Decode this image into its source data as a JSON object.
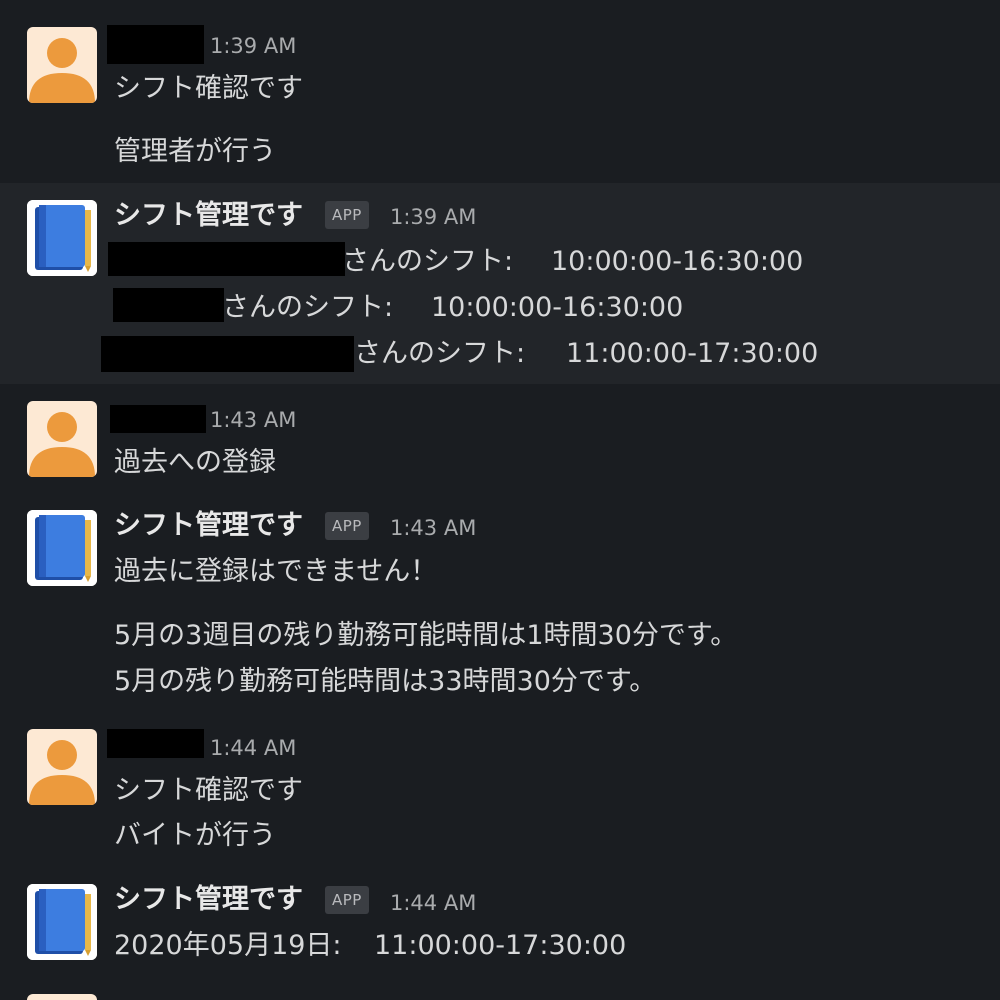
{
  "colors": {
    "background": "#1a1d21",
    "highlight_row": "#222529",
    "user_avatar_bg": "#fde9d4",
    "user_avatar_fg": "#ec9a3d",
    "app_icon_blue": "#2f6fd6",
    "text": "#d7d8d9",
    "timestamp": "#a9abad"
  },
  "app_name": "シフト管理です",
  "app_badge": "APP",
  "messages": [
    {
      "author": "user",
      "avatar_icon": "user-avatar-icon",
      "time": "1:39 AM",
      "lines": [
        "シフト確認です",
        "管理者が行う"
      ]
    },
    {
      "author": "app",
      "avatar_icon": "notebook-app-icon",
      "time": "1:39 AM",
      "lines": [
        {
          "suffix": "さんのシフト:",
          "range": "10:00:00-16:30:00"
        },
        {
          "suffix": "さんのシフト:",
          "range": "10:00:00-16:30:00"
        },
        {
          "suffix": "さんのシフト:",
          "range": "11:00:00-17:30:00"
        }
      ]
    },
    {
      "author": "user",
      "avatar_icon": "user-avatar-icon",
      "time": "1:43 AM",
      "lines": [
        "過去への登録"
      ]
    },
    {
      "author": "app",
      "avatar_icon": "notebook-app-icon",
      "time": "1:43 AM",
      "lines": [
        "過去に登録はできません！",
        "5月の3週目の残り勤務可能時間は1時間30分です。",
        "5月の残り勤務可能時間は33時間30分です。"
      ]
    },
    {
      "author": "user",
      "avatar_icon": "user-avatar-icon",
      "time": "1:44 AM",
      "lines": [
        "シフト確認です",
        "バイトが行う"
      ]
    },
    {
      "author": "app",
      "avatar_icon": "notebook-app-icon",
      "time": "1:44 AM",
      "lines": [
        {
          "date": "2020年05月19日:",
          "range": "11:00:00-17:30:00"
        }
      ]
    }
  ]
}
